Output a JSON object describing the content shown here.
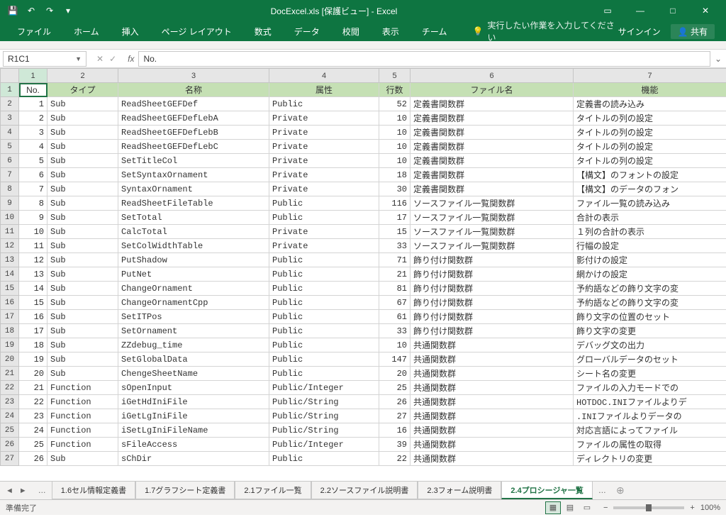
{
  "title": "DocExcel.xls  [保護ビュー] - Excel",
  "qat": {
    "save": "💾",
    "undo": "↶",
    "redo": "↷",
    "custom": "▾"
  },
  "winbtns": {
    "ribbon": "▭",
    "min": "—",
    "max": "□",
    "close": "✕"
  },
  "tabs": [
    "ファイル",
    "ホーム",
    "挿入",
    "ページ レイアウト",
    "数式",
    "データ",
    "校閲",
    "表示",
    "チーム"
  ],
  "tellme": "実行したい作業を入力してください",
  "signin": "サインイン",
  "share": "共有",
  "namebox": "R1C1",
  "fx": "No.",
  "colnums": [
    "1",
    "2",
    "3",
    "4",
    "5",
    "6",
    "7"
  ],
  "headers": [
    "No.",
    "タイプ",
    "名称",
    "属性",
    "行数",
    "ファイル名",
    "機能"
  ],
  "rows": [
    {
      "r": "1",
      "no": "1",
      "type": "Sub",
      "name": "ReadSheetGEFDef",
      "attr": "Public",
      "lines": "52",
      "file": "定義書関数群",
      "func": "定義書の読み込み"
    },
    {
      "r": "2",
      "no": "2",
      "type": "Sub",
      "name": "ReadSheetGEFDefLebA",
      "attr": "Private",
      "lines": "10",
      "file": "定義書関数群",
      "func": "タイトルの列の設定"
    },
    {
      "r": "3",
      "no": "3",
      "type": "Sub",
      "name": "ReadSheetGEFDefLebB",
      "attr": "Private",
      "lines": "10",
      "file": "定義書関数群",
      "func": "タイトルの列の設定"
    },
    {
      "r": "4",
      "no": "4",
      "type": "Sub",
      "name": "ReadSheetGEFDefLebC",
      "attr": "Private",
      "lines": "10",
      "file": "定義書関数群",
      "func": "タイトルの列の設定"
    },
    {
      "r": "5",
      "no": "5",
      "type": "Sub",
      "name": "SetTitleCol",
      "attr": "Private",
      "lines": "10",
      "file": "定義書関数群",
      "func": "タイトルの列の設定"
    },
    {
      "r": "6",
      "no": "6",
      "type": "Sub",
      "name": "SetSyntaxOrnament",
      "attr": "Private",
      "lines": "18",
      "file": "定義書関数群",
      "func": "【構文】のフォントの設定"
    },
    {
      "r": "7",
      "no": "7",
      "type": "Sub",
      "name": "SyntaxOrnament",
      "attr": "Private",
      "lines": "30",
      "file": "定義書関数群",
      "func": "【構文】のデータのフォン"
    },
    {
      "r": "8",
      "no": "8",
      "type": "Sub",
      "name": "ReadSheetFileTable",
      "attr": "Public",
      "lines": "116",
      "file": "ソースファイル一覧関数群",
      "func": "ファイル一覧の読み込み"
    },
    {
      "r": "9",
      "no": "9",
      "type": "Sub",
      "name": "SetTotal",
      "attr": "Public",
      "lines": "17",
      "file": "ソースファイル一覧関数群",
      "func": "合計の表示"
    },
    {
      "r": "10",
      "no": "10",
      "type": "Sub",
      "name": "CalcTotal",
      "attr": "Private",
      "lines": "15",
      "file": "ソースファイル一覧関数群",
      "func": "１列の合計の表示"
    },
    {
      "r": "11",
      "no": "11",
      "type": "Sub",
      "name": "SetColWidthTable",
      "attr": "Private",
      "lines": "33",
      "file": "ソースファイル一覧関数群",
      "func": "行幅の設定"
    },
    {
      "r": "12",
      "no": "12",
      "type": "Sub",
      "name": "PutShadow",
      "attr": "Public",
      "lines": "71",
      "file": "飾り付け関数群",
      "func": "影付けの設定"
    },
    {
      "r": "13",
      "no": "13",
      "type": "Sub",
      "name": "PutNet",
      "attr": "Public",
      "lines": "21",
      "file": "飾り付け関数群",
      "func": "網かけの設定"
    },
    {
      "r": "14",
      "no": "14",
      "type": "Sub",
      "name": "ChangeOrnament",
      "attr": "Public",
      "lines": "81",
      "file": "飾り付け関数群",
      "func": "予約語などの飾り文字の変"
    },
    {
      "r": "15",
      "no": "15",
      "type": "Sub",
      "name": "ChangeOrnamentCpp",
      "attr": "Public",
      "lines": "67",
      "file": "飾り付け関数群",
      "func": "予約語などの飾り文字の変"
    },
    {
      "r": "16",
      "no": "16",
      "type": "Sub",
      "name": "SetITPos",
      "attr": "Public",
      "lines": "61",
      "file": "飾り付け関数群",
      "func": "飾り文字の位置のセット"
    },
    {
      "r": "17",
      "no": "17",
      "type": "Sub",
      "name": "SetOrnament",
      "attr": "Public",
      "lines": "33",
      "file": "飾り付け関数群",
      "func": "飾り文字の変更"
    },
    {
      "r": "18",
      "no": "18",
      "type": "Sub",
      "name": "ZZdebug_time",
      "attr": "Public",
      "lines": "10",
      "file": "共通関数群",
      "func": "デバッグ文の出力"
    },
    {
      "r": "19",
      "no": "19",
      "type": "Sub",
      "name": "SetGlobalData",
      "attr": "Public",
      "lines": "147",
      "file": "共通関数群",
      "func": "グローバルデータのセット"
    },
    {
      "r": "20",
      "no": "20",
      "type": "Sub",
      "name": "ChengeSheetName",
      "attr": "Public",
      "lines": "20",
      "file": "共通関数群",
      "func": "シート名の変更"
    },
    {
      "r": "21",
      "no": "21",
      "type": "Function",
      "name": "sOpenInput",
      "attr": "Public/Integer",
      "lines": "25",
      "file": "共通関数群",
      "func": "ファイルの入力モードでの"
    },
    {
      "r": "22",
      "no": "22",
      "type": "Function",
      "name": "iGetHdIniFile",
      "attr": "Public/String",
      "lines": "26",
      "file": "共通関数群",
      "func": "HOTDOC.INIファイルよりデ"
    },
    {
      "r": "23",
      "no": "23",
      "type": "Function",
      "name": "iGetLgIniFile",
      "attr": "Public/String",
      "lines": "27",
      "file": "共通関数群",
      "func": ".INIファイルよりデータの"
    },
    {
      "r": "24",
      "no": "24",
      "type": "Function",
      "name": "iSetLgIniFileName",
      "attr": "Public/String",
      "lines": "16",
      "file": "共通関数群",
      "func": "対応言語によってファイル"
    },
    {
      "r": "25",
      "no": "25",
      "type": "Function",
      "name": "sFileAccess",
      "attr": "Public/Integer",
      "lines": "39",
      "file": "共通関数群",
      "func": "ファイルの属性の取得"
    },
    {
      "r": "26",
      "no": "26",
      "type": "Sub",
      "name": "sChDir",
      "attr": "Public",
      "lines": "22",
      "file": "共通関数群",
      "func": "ディレクトリの変更"
    }
  ],
  "sheets": [
    "1.6セル情報定義書",
    "1.7グラフシート定義書",
    "2.1ファイル一覧",
    "2.2ソースファイル説明書",
    "2.3フォーム説明書",
    "2.4プロシージャ一覧"
  ],
  "activeSheet": 5,
  "status": "準備完了",
  "zoom": "100%"
}
